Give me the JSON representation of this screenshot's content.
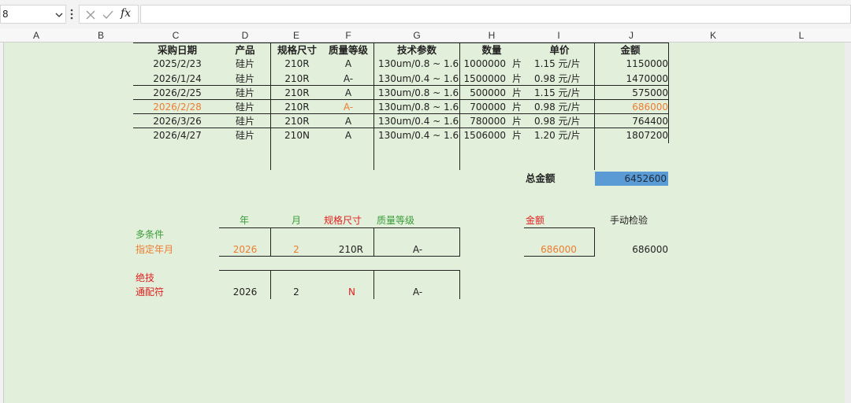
{
  "namebox": {
    "value": "8"
  },
  "formula_bar": {
    "fx_label": "fx",
    "value": ""
  },
  "columns": [
    "A",
    "B",
    "C",
    "D",
    "E",
    "F",
    "G",
    "H",
    "I",
    "J",
    "K",
    "L"
  ],
  "table": {
    "headers": [
      "采购日期",
      "产品",
      "规格尺寸",
      "质量等级",
      "技术参数",
      "数量",
      "单价",
      "金额"
    ],
    "rows": [
      {
        "date": "2025/2/23",
        "product": "硅片",
        "size": "210R",
        "grade": "A",
        "spec": "130um/0.8 ~ 1.6",
        "qty": "1000000",
        "qty_unit": "片",
        "price": "1.15 元/片",
        "amount": "1150000",
        "highlight": false
      },
      {
        "date": "2026/1/24",
        "product": "硅片",
        "size": "210R",
        "grade": "A-",
        "spec": "130um/0.4 ~ 1.6",
        "qty": "1500000",
        "qty_unit": "片",
        "price": "0.98 元/片",
        "amount": "1470000",
        "highlight": false
      },
      {
        "date": "2026/2/25",
        "product": "硅片",
        "size": "210R",
        "grade": "A",
        "spec": "130um/0.8 ~ 1.6",
        "qty": "500000",
        "qty_unit": "片",
        "price": "1.15 元/片",
        "amount": "575000",
        "highlight": false
      },
      {
        "date": "2026/2/28",
        "product": "硅片",
        "size": "210R",
        "grade": "A-",
        "spec": "130um/0.8 ~ 1.6",
        "qty": "700000",
        "qty_unit": "片",
        "price": "0.98 元/片",
        "amount": "686000",
        "highlight": true
      },
      {
        "date": "2026/3/26",
        "product": "硅片",
        "size": "210R",
        "grade": "A",
        "spec": "130um/0.4 ~ 1.6",
        "qty": "780000",
        "qty_unit": "片",
        "price": "0.98 元/片",
        "amount": "764400",
        "highlight": false
      },
      {
        "date": "2026/4/27",
        "product": "硅片",
        "size": "210N",
        "grade": "A",
        "spec": "130um/0.4 ~ 1.6",
        "qty": "1506000",
        "qty_unit": "片",
        "price": "1.20 元/片",
        "amount": "1807200",
        "highlight": false
      }
    ],
    "total_label": "总金额",
    "total_value": "6452600"
  },
  "criteria": {
    "headers": {
      "year": "年",
      "month": "月",
      "size": "规格尺寸",
      "grade": "质量等级",
      "amount": "金额",
      "manual": "手动检验"
    },
    "block1": {
      "label1": "多条件",
      "label2": "指定年月",
      "year": "2026",
      "month": "2",
      "size": "210R",
      "grade": "A-",
      "amount": "686000",
      "manual": "686000"
    },
    "block2": {
      "label1": "绝技",
      "label2": "通配符",
      "year": "2026",
      "month": "2",
      "size": "N",
      "grade": "A-"
    }
  },
  "colors": {
    "sheet_bg": "#e2efda",
    "total_bg": "#5b9bd5",
    "orange": "#ed7d31",
    "green": "#3a9d3a",
    "red": "#e02020"
  }
}
